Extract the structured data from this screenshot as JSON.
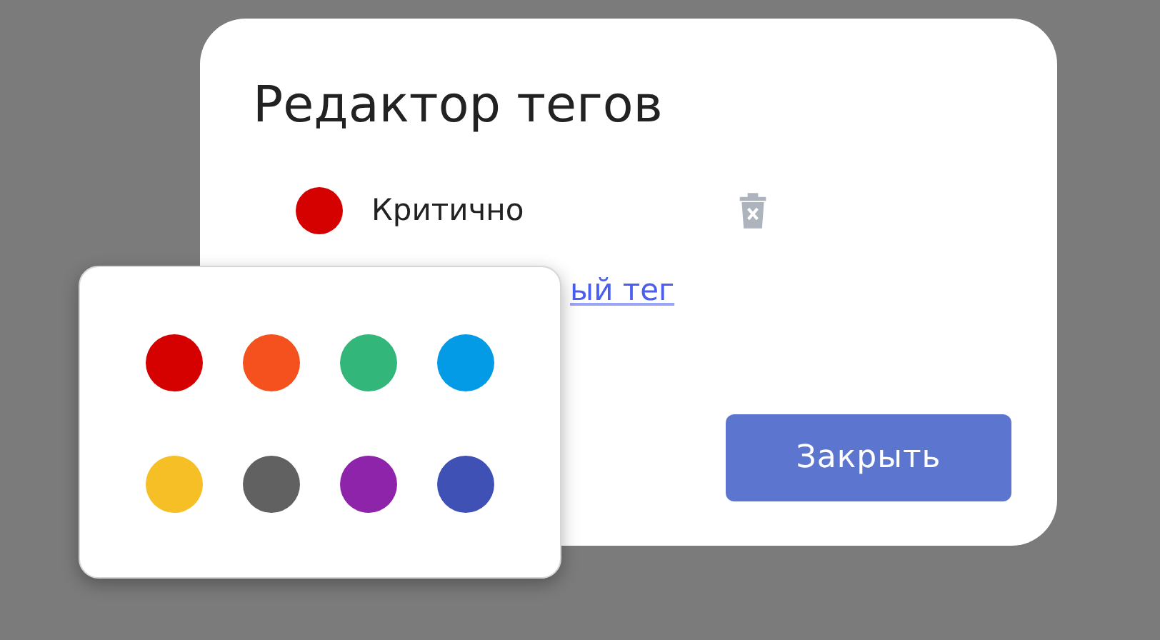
{
  "dialog": {
    "title": "Редактор тегов",
    "tags": [
      {
        "name": "Критично",
        "color": "#d50000"
      }
    ],
    "add_link": "ый тег",
    "close_button": "Закрыть"
  },
  "color_picker": {
    "swatches": [
      {
        "color": "#d50000"
      },
      {
        "color": "#f4511e"
      },
      {
        "color": "#33b679"
      },
      {
        "color": "#039be5"
      },
      {
        "color": "#f6bf26"
      },
      {
        "color": "#616161"
      },
      {
        "color": "#8e24aa"
      },
      {
        "color": "#3f51b5"
      }
    ]
  }
}
